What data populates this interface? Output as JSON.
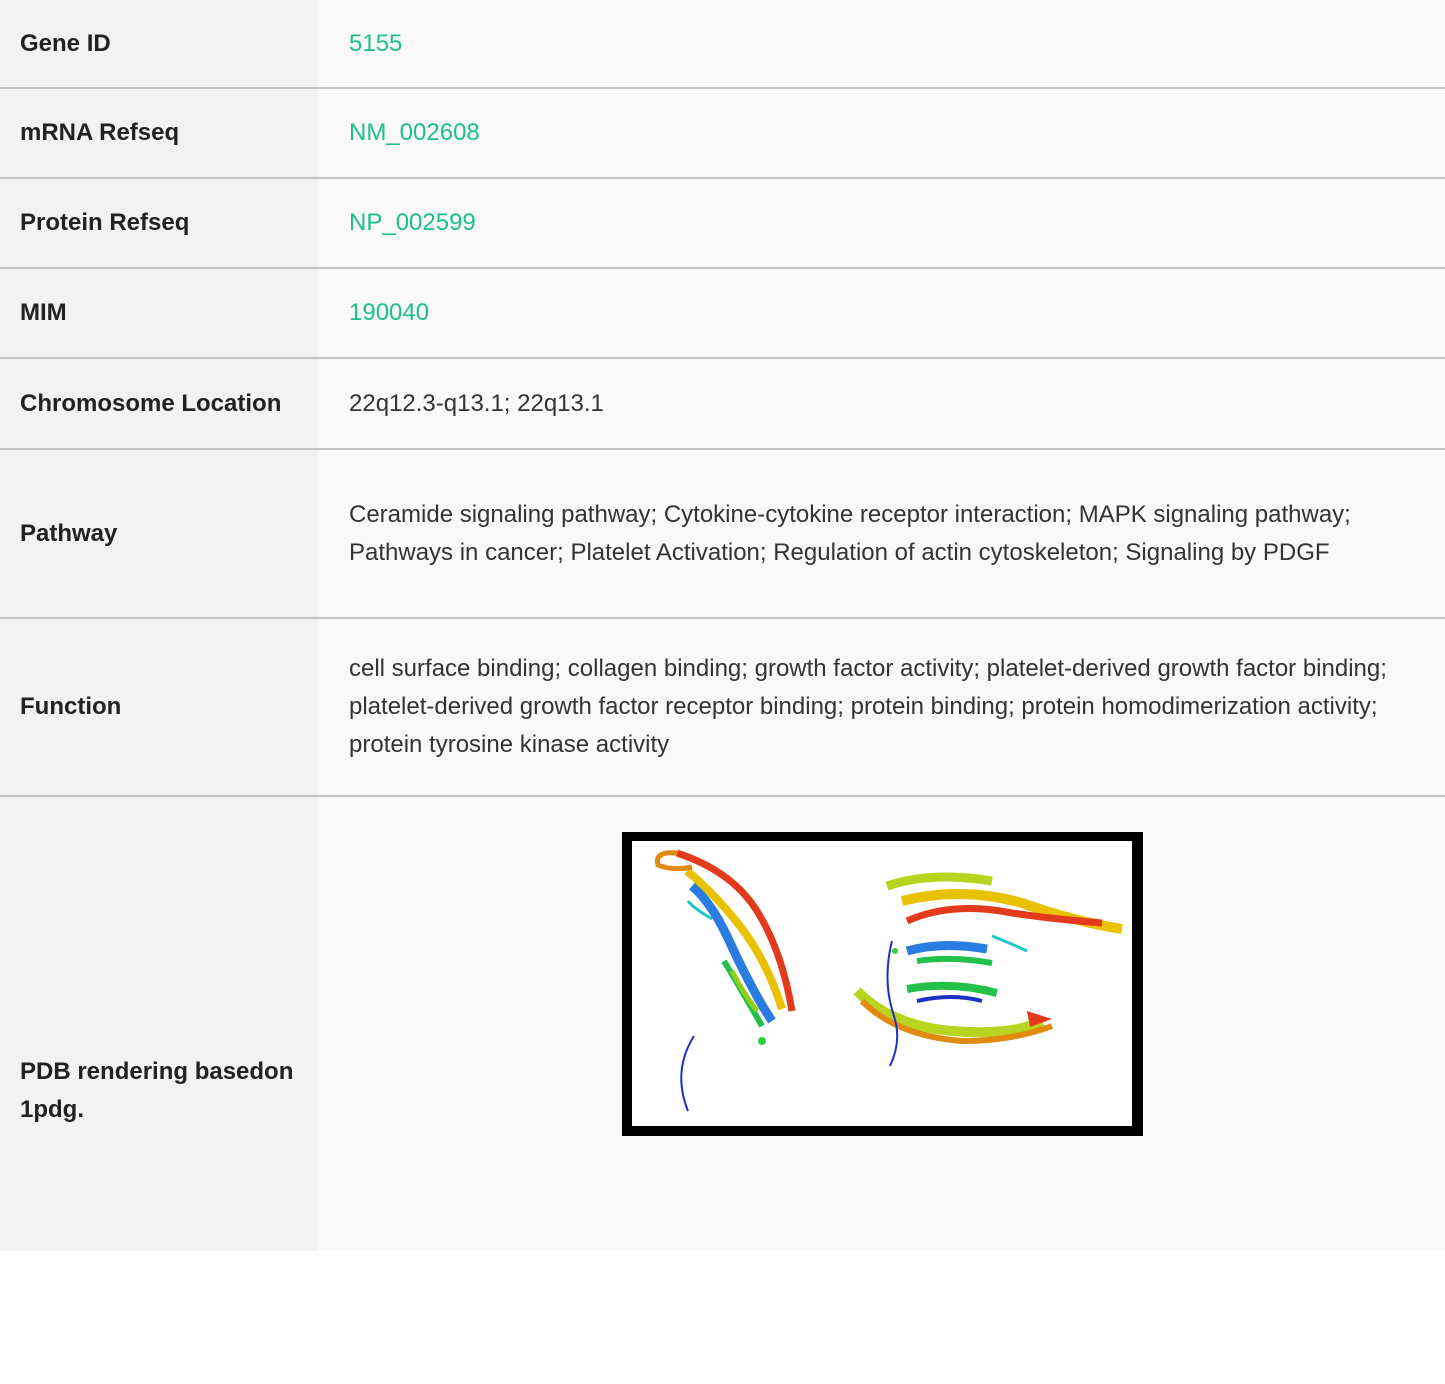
{
  "rows": [
    {
      "label": "Gene ID",
      "value": "5155",
      "is_link": true
    },
    {
      "label": "mRNA Refseq",
      "value": "NM_002608",
      "is_link": true
    },
    {
      "label": "Protein Refseq",
      "value": "NP_002599",
      "is_link": true
    },
    {
      "label": "MIM",
      "value": "190040",
      "is_link": true
    },
    {
      "label": "Chromosome Location",
      "value": "22q12.3-q13.1; 22q13.1",
      "is_link": false
    },
    {
      "label": "Pathway",
      "value": "Ceramide signaling pathway; Cytokine-cytokine receptor interaction; MAPK signaling pathway; Pathways in cancer; Platelet Activation; Regulation of actin cytoskeleton; Signaling by PDGF",
      "is_link": false
    },
    {
      "label": "Function",
      "value": "cell surface binding; collagen binding; growth factor activity; platelet-derived growth factor binding; platelet-derived growth factor receptor binding; protein binding; protein homodimerization activity; protein tyrosine kinase activity",
      "is_link": false
    },
    {
      "label": "PDB rendering basedon 1pdg.",
      "value": "",
      "is_link": false
    }
  ],
  "colors": {
    "link": "#1cbf8a",
    "label_bg": "#f2f2f2",
    "value_bg": "#f9f9f9",
    "divider": "#c4c4c4"
  }
}
